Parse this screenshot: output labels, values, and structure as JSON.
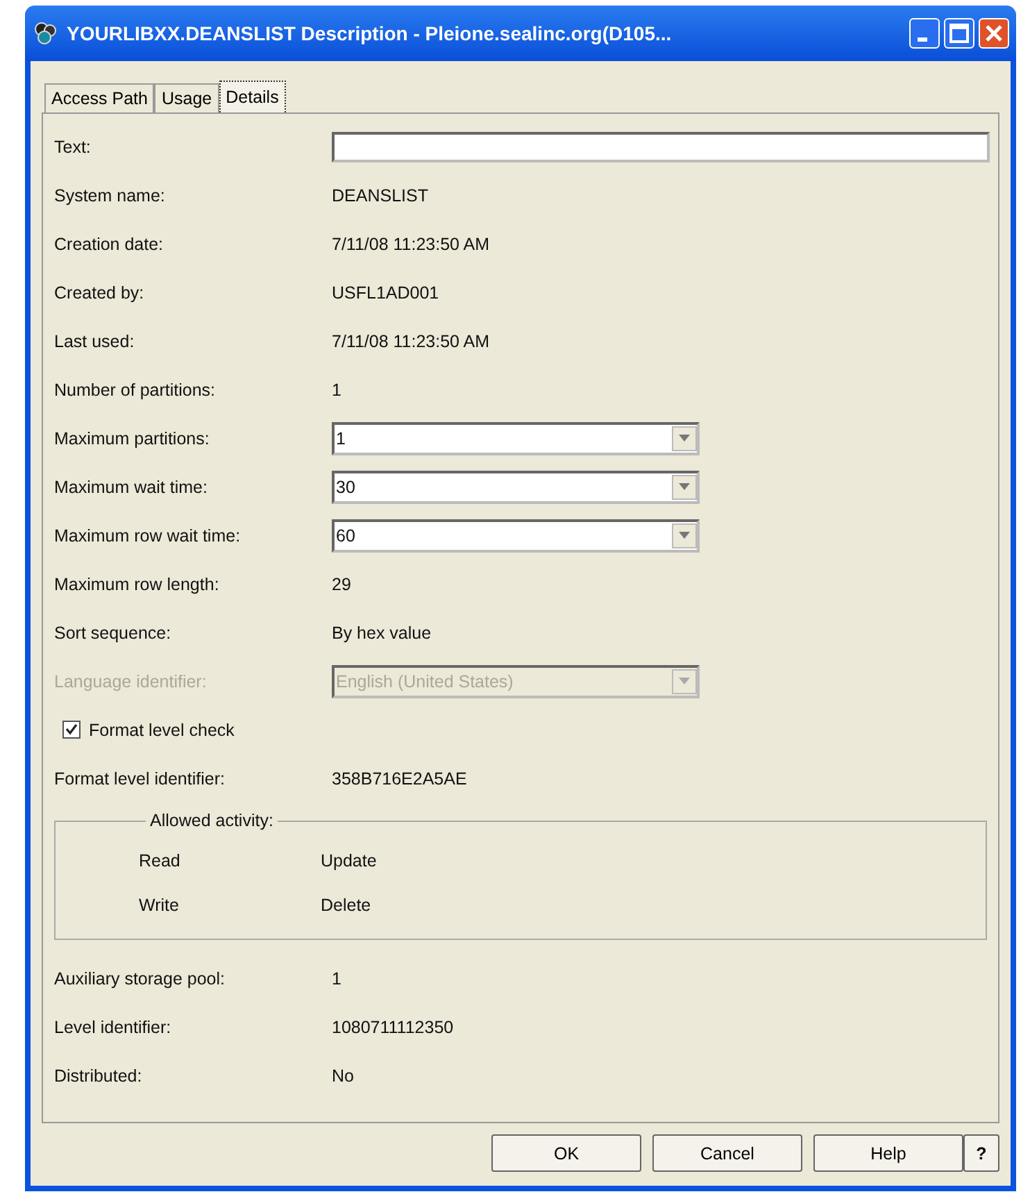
{
  "window": {
    "title": "YOURLIBXX.DEANSLIST Description - Pleione.sealinc.org(D105..."
  },
  "tabs": [
    {
      "label": "Access Path",
      "selected": false
    },
    {
      "label": "Usage",
      "selected": false
    },
    {
      "label": "Details",
      "selected": true
    }
  ],
  "fields": [
    {
      "kind": "input",
      "label": "Text:"
    },
    {
      "kind": "value",
      "label": "System name:",
      "value": "DEANSLIST"
    },
    {
      "kind": "value",
      "label": "Creation date:",
      "value": "7/11/08 11:23:50 AM"
    },
    {
      "kind": "value",
      "label": "Created by:",
      "value": "USFL1AD001"
    },
    {
      "kind": "value",
      "label": "Last used:",
      "value": "7/11/08 11:23:50 AM"
    },
    {
      "kind": "value",
      "label": "Number of partitions:",
      "value": "1"
    },
    {
      "kind": "combo",
      "label": "Maximum partitions:",
      "value": "1",
      "disabled": false
    },
    {
      "kind": "combo",
      "label": "Maximum wait time:",
      "value": "30",
      "disabled": false
    },
    {
      "kind": "combo",
      "label": "Maximum row wait time:",
      "value": "60",
      "disabled": false
    },
    {
      "kind": "value",
      "label": "Maximum row length:",
      "value": "29"
    },
    {
      "kind": "value",
      "label": "Sort sequence:",
      "value": "By hex value"
    },
    {
      "kind": "combo",
      "label": "Language identifier:",
      "value": "English (United States)",
      "disabled": true
    },
    {
      "kind": "checkbox",
      "label": "Format level check",
      "checked": true
    },
    {
      "kind": "value",
      "label": "Format level identifier:",
      "value": "358B716E2A5AE"
    }
  ],
  "allowed_activity": {
    "title": "Allowed activity:",
    "items": [
      [
        "Read",
        "Update"
      ],
      [
        "Write",
        "Delete"
      ]
    ]
  },
  "fields_after": [
    {
      "label": "Auxiliary storage pool:",
      "value": "1"
    },
    {
      "label": "Level identifier:",
      "value": "1080711112350"
    },
    {
      "label": "Distributed:",
      "value": "No"
    }
  ],
  "buttons": [
    "OK",
    "Cancel",
    "Help",
    "?"
  ]
}
